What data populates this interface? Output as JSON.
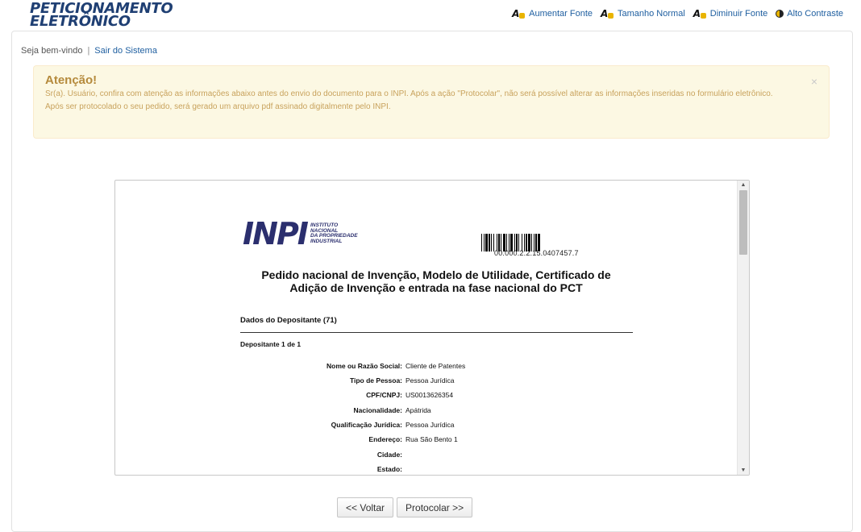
{
  "brand": {
    "line1": "PETICIONAMENTO",
    "line2": "ELETRÔNICO"
  },
  "accessibility": [
    {
      "label": "Aumentar Fonte",
      "icon": "font-increase-icon"
    },
    {
      "label": "Tamanho Normal",
      "icon": "font-normal-icon"
    },
    {
      "label": "Diminuir Fonte",
      "icon": "font-decrease-icon"
    },
    {
      "label": "Alto Contraste",
      "icon": "contrast-icon"
    }
  ],
  "session": {
    "welcome": "Seja bem-vindo",
    "separator": "|",
    "logout": "Sair do Sistema"
  },
  "alert": {
    "title": "Atenção!",
    "line1": "Sr(a). Usuário, confira com atenção as informações abaixo antes do envio do documento para o INPI. Após a ação \"Protocolar\", não será possível alterar as informações inseridas no formulário eletrônico.",
    "line2": "Após ser protocolado o seu pedido, será gerado um arquivo pdf assinado digitalmente pelo INPI.",
    "close": "×"
  },
  "document": {
    "logo_mark": "INPI",
    "logo_text": [
      "INSTITUTO",
      "NACIONAL",
      "DA PROPRIEDADE",
      "INDUSTRIAL"
    ],
    "barcode_number": "00.000.2.2.15.0407457.7",
    "title_line1": "Pedido nacional de Invenção, Modelo de Utilidade, Certificado de",
    "title_line2": "Adição de Invenção e entrada na fase nacional do PCT",
    "section_title": "Dados do Depositante (71)",
    "subsection": "Depositante 1 de 1",
    "fields": [
      {
        "label": "Nome ou Razão Social:",
        "value": "Cliente de Patentes"
      },
      {
        "label": "Tipo de Pessoa:",
        "value": "Pessoa Jurídica"
      },
      {
        "label": "CPF/CNPJ:",
        "value": "US0013626354"
      },
      {
        "label": "Nacionalidade:",
        "value": "Apátrida"
      },
      {
        "label": "Qualificação Jurídica:",
        "value": "Pessoa Jurídica"
      },
      {
        "label": "Endereço:",
        "value": "Rua São Bento 1"
      },
      {
        "label": "Cidade:",
        "value": ""
      },
      {
        "label": "Estado:",
        "value": ""
      }
    ]
  },
  "buttons": {
    "back": "<< Voltar",
    "submit": "Protocolar >>"
  },
  "colors": {
    "brand": "#1f3f73",
    "link": "#1f5fa0",
    "alert_bg": "#fcf8e3",
    "alert_text": "#c8a25c",
    "icon_accent": "#e9b400"
  }
}
